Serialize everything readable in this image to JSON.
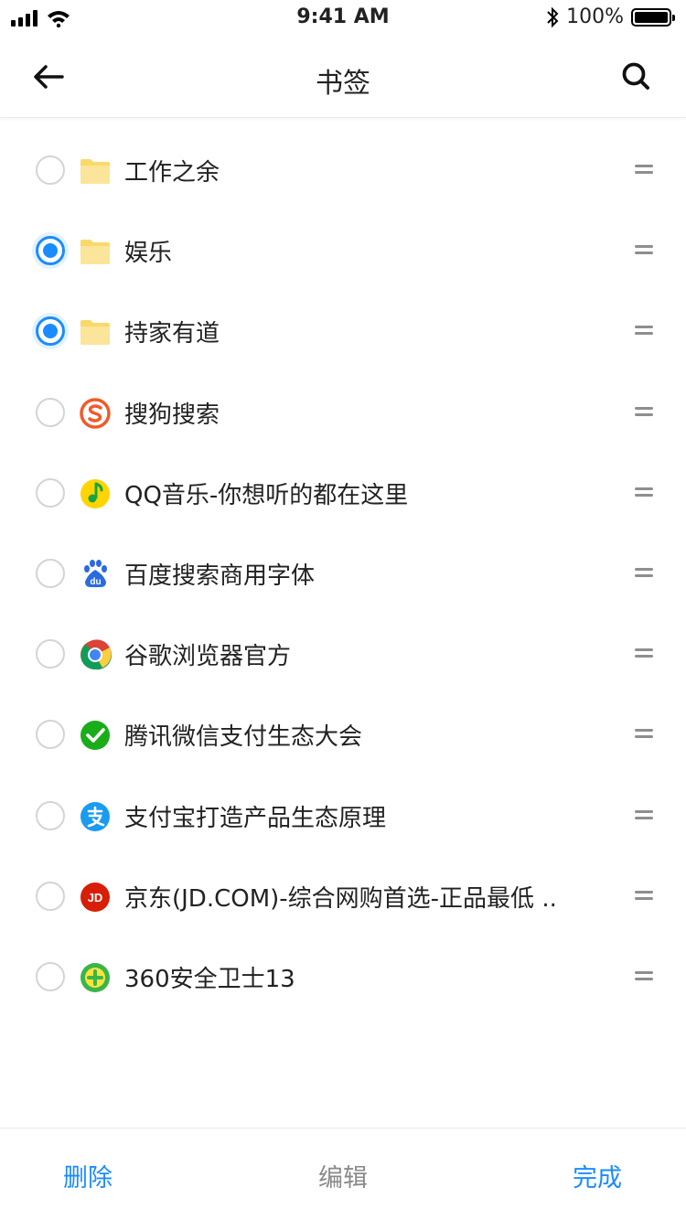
{
  "status": {
    "time": "9:41 AM",
    "battery": "100%",
    "battery_level": 1.0
  },
  "nav": {
    "title": "书签",
    "back_icon": "arrow-left-icon",
    "search_icon": "search-icon"
  },
  "colors": {
    "accent": "#1a8cff",
    "muted": "#8a8a8a",
    "folder": "#f9d96a"
  },
  "bookmarks": [
    {
      "label": "工作之余",
      "checked": false,
      "icon": "folder-icon"
    },
    {
      "label": "娱乐",
      "checked": true,
      "icon": "folder-icon"
    },
    {
      "label": "持家有道",
      "checked": true,
      "icon": "folder-icon"
    },
    {
      "label": "搜狗搜索",
      "checked": false,
      "icon": "sogou-icon"
    },
    {
      "label": "QQ音乐-你想听的都在这里",
      "checked": false,
      "icon": "qq-music-icon"
    },
    {
      "label": "百度搜索商用字体",
      "checked": false,
      "icon": "baidu-icon"
    },
    {
      "label": "谷歌浏览器官方",
      "checked": false,
      "icon": "chrome-icon"
    },
    {
      "label": "腾讯微信支付生态大会",
      "checked": false,
      "icon": "wechat-icon"
    },
    {
      "label": "支付宝打造产品生态原理",
      "checked": false,
      "icon": "alipay-icon"
    },
    {
      "label": "京东(JD.COM)-综合网购首选-正品最低 ..",
      "checked": false,
      "icon": "jd-icon"
    },
    {
      "label": "360安全卫士13",
      "checked": false,
      "icon": "360-icon"
    }
  ],
  "icon_text": {
    "jd": "JD",
    "baidu": "du"
  },
  "bottom": {
    "delete_label": "删除",
    "edit_label": "编辑",
    "done_label": "完成"
  }
}
